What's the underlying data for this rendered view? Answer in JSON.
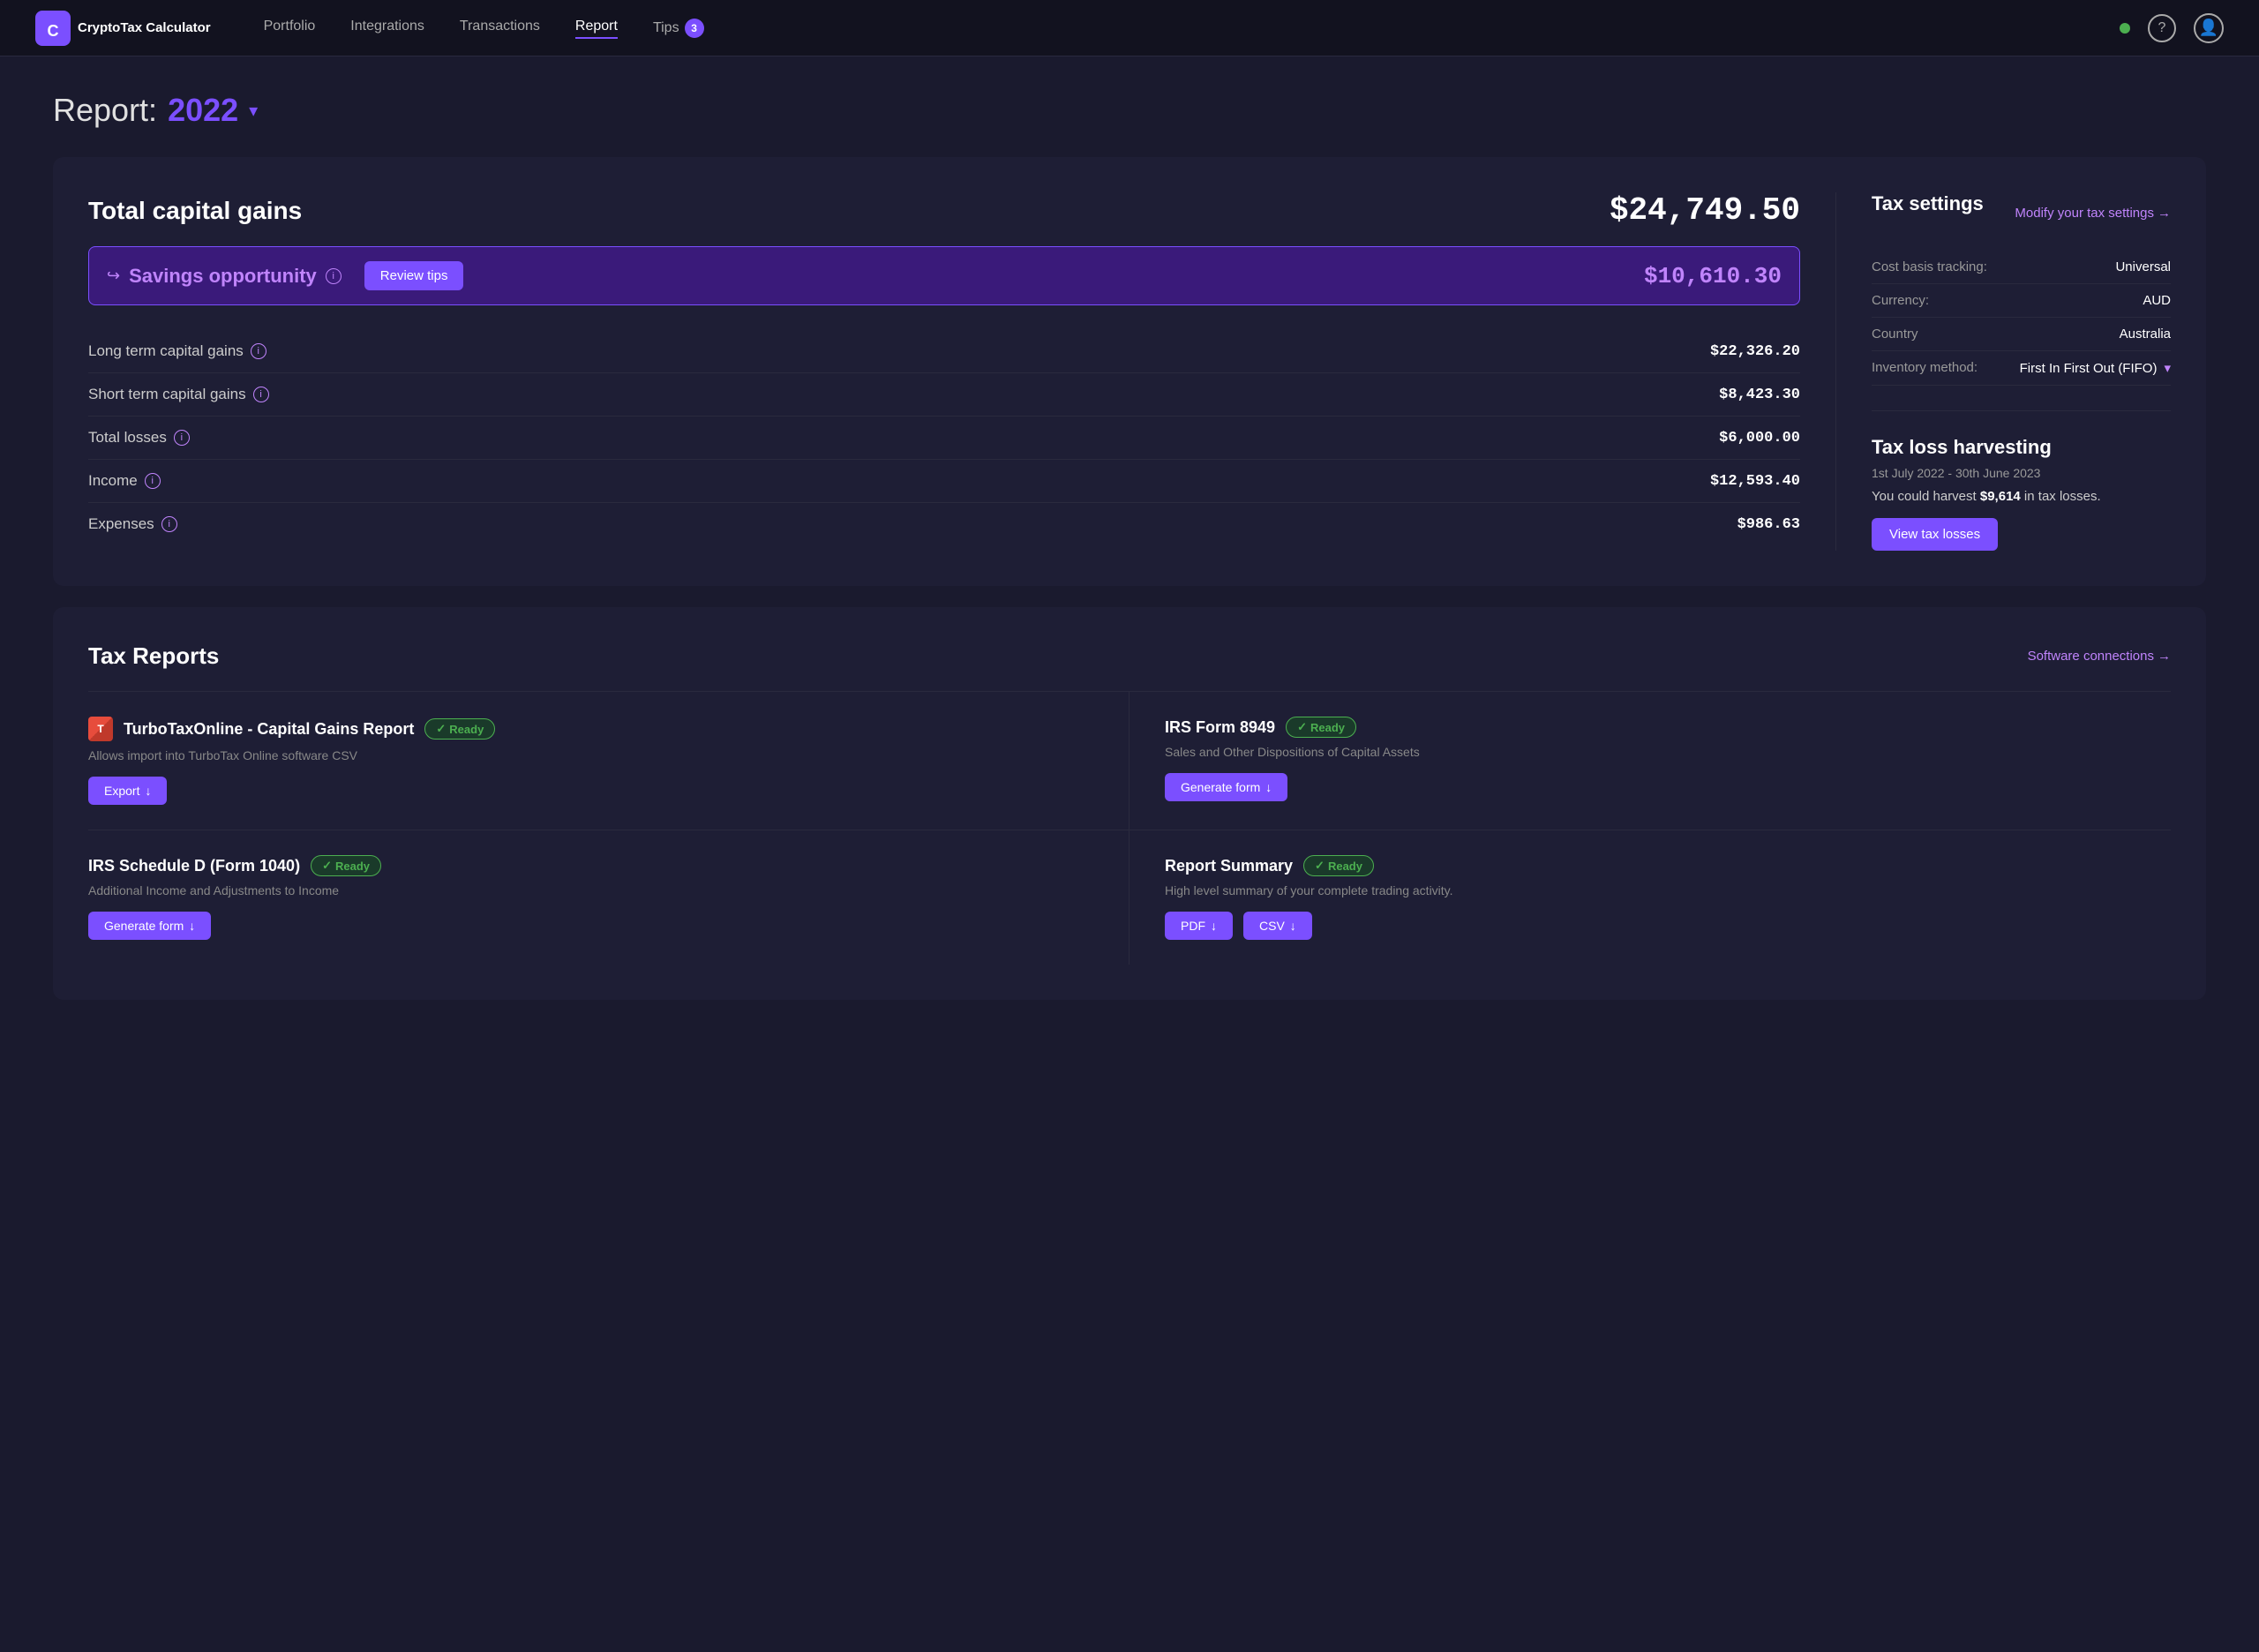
{
  "nav": {
    "logo_text": "CryptoTax Calculator",
    "links": [
      {
        "label": "Portfolio",
        "active": false
      },
      {
        "label": "Integrations",
        "active": false
      },
      {
        "label": "Transactions",
        "active": false
      },
      {
        "label": "Report",
        "active": true
      },
      {
        "label": "Tips",
        "active": false
      }
    ],
    "tips_count": "3",
    "help_icon": "?",
    "user_icon": "👤"
  },
  "page": {
    "title_label": "Report:",
    "title_year": "2022",
    "chevron": "▾"
  },
  "capital_gains": {
    "title": "Total capital gains",
    "amount": "$24,749.50",
    "savings": {
      "label": "Savings opportunity",
      "button": "Review tips",
      "amount": "$10,610.30"
    },
    "line_items": [
      {
        "label": "Long term capital gains",
        "value": "$22,326.20"
      },
      {
        "label": "Short term capital gains",
        "value": "$8,423.30"
      },
      {
        "label": "Total losses",
        "value": "$6,000.00"
      },
      {
        "label": "Income",
        "value": "$12,593.40"
      },
      {
        "label": "Expenses",
        "value": "$986.63"
      }
    ]
  },
  "tax_settings": {
    "title": "Tax settings",
    "modify_label": "Modify your tax settings",
    "arrow": "→",
    "rows": [
      {
        "key": "Cost basis tracking:",
        "value": "Universal"
      },
      {
        "key": "Currency:",
        "value": "AUD"
      },
      {
        "key": "Country",
        "value": "Australia"
      },
      {
        "key": "Inventory method:",
        "value": "First In First Out (FIFO)",
        "dropdown": true
      }
    ]
  },
  "tax_loss_harvesting": {
    "title": "Tax loss harvesting",
    "date_range": "1st July 2022 - 30th June 2023",
    "harvest_text_pre": "You could harvest ",
    "harvest_amount": "$9,614",
    "harvest_text_post": " in tax losses.",
    "button": "View tax losses"
  },
  "tax_reports": {
    "title": "Tax Reports",
    "software_link": "Software connections",
    "arrow": "→",
    "reports": [
      {
        "icon": "turbotax",
        "name": "TurboTaxOnline - Capital Gains Report",
        "status": "Ready",
        "description": "Allows import into TurboTax Online software CSV",
        "actions": [
          {
            "label": "Export",
            "icon": "↓"
          }
        ]
      },
      {
        "icon": null,
        "name": "IRS Form 8949",
        "status": "Ready",
        "description": "Sales and Other Dispositions of Capital Assets",
        "actions": [
          {
            "label": "Generate form",
            "icon": "↓"
          }
        ]
      },
      {
        "icon": null,
        "name": "IRS Schedule D (Form 1040)",
        "status": "Ready",
        "description": "Additional Income and Adjustments to Income",
        "actions": [
          {
            "label": "Generate form",
            "icon": "↓"
          }
        ]
      },
      {
        "icon": null,
        "name": "Report Summary",
        "status": "Ready",
        "description": "High level summary of your complete trading activity.",
        "actions": [
          {
            "label": "PDF",
            "icon": "↓"
          },
          {
            "label": "CSV",
            "icon": "↓"
          }
        ]
      }
    ]
  }
}
